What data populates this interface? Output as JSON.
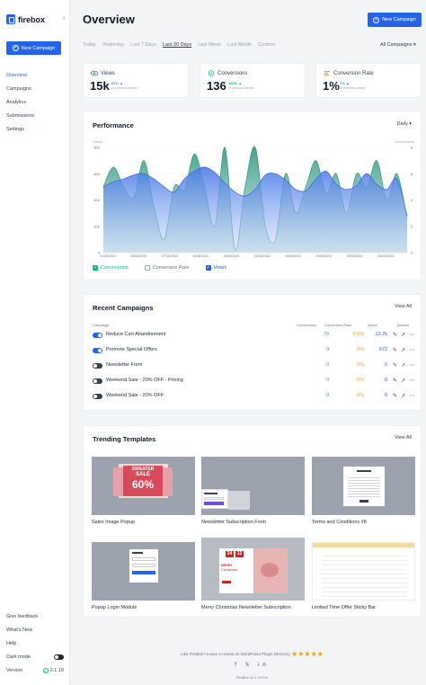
{
  "sidebar": {
    "logo_text": "firebox",
    "collapse_glyph": "‹",
    "new_campaign": "New Campaign",
    "nav": [
      {
        "label": "Overview",
        "active": true
      },
      {
        "label": "Campaigns"
      },
      {
        "label": "Analytics"
      },
      {
        "label": "Submissions"
      },
      {
        "label": "Settings"
      }
    ],
    "bottom": {
      "feedback": "Give feedback",
      "whats_new": "What's New",
      "help": "Help",
      "dark_mode": "Dark mode",
      "version_label": "Version",
      "version_value": "2.1.19"
    }
  },
  "header": {
    "title": "Overview",
    "new_campaign": "New Campaign",
    "date_tabs": [
      "Today",
      "Yesterday",
      "Last 7 Days",
      "Last 30 Days",
      "Last Week",
      "Last Month",
      "Custom"
    ],
    "active_tab": "Last 30 Days",
    "campaign_filter": "All Campaigns ▾"
  },
  "stats": [
    {
      "label": "Views",
      "value": "15k",
      "change": "67% ▲",
      "note": "vs previous period",
      "icon": "eye-icon",
      "color": "#2563eb"
    },
    {
      "label": "Conversions",
      "value": "136",
      "change": "100% ▲",
      "note": "vs previous period",
      "icon": "conversions-icon",
      "color": "#10b981"
    },
    {
      "label": "Conversion Rate",
      "value": "1%",
      "change": "7% ▲",
      "note": "vs previous period",
      "icon": "rate-icon",
      "color": "#f59e0b"
    }
  ],
  "performance": {
    "title": "Performance",
    "interval": "Daily ▾",
    "legend": {
      "conversions": "Conversions",
      "conversion_rate": "Conversion Rate",
      "views": "Views"
    }
  },
  "chart_data": {
    "type": "area",
    "title": "Performance",
    "xlabel": "",
    "ylabel": "Views",
    "y2label": "Conversions",
    "x": [
      "01/08/2024",
      "04/08/2024",
      "07/08/2024",
      "10/08/2024",
      "13/08/2024",
      "16/08/2024",
      "19/08/2024",
      "22/08/2024",
      "25/08/2024",
      "28/08/2024"
    ],
    "ylim": [
      0,
      800
    ],
    "y_ticks": [
      0,
      200,
      400,
      600,
      800
    ],
    "y2lim": [
      0,
      8
    ],
    "y2_ticks": [
      0,
      2,
      4,
      6,
      8
    ],
    "series": [
      {
        "name": "Views",
        "axis": "left",
        "color": "#3b6fe0",
        "values": [
          500,
          540,
          560,
          590,
          600,
          560,
          500,
          460,
          560,
          620,
          650,
          610,
          530,
          460,
          430,
          480,
          590,
          600,
          550,
          480,
          470,
          560,
          620,
          520,
          480,
          510,
          600,
          520,
          480,
          560,
          280
        ]
      },
      {
        "name": "Conversions",
        "axis": "right",
        "color": "#3d9b86",
        "values": [
          5,
          6.5,
          5,
          4.2,
          7,
          3.5,
          1,
          5,
          4.8,
          7.5,
          5,
          2,
          8,
          0.2,
          5,
          8,
          2,
          1,
          6,
          3,
          5,
          7,
          4.5,
          6,
          3,
          6,
          5,
          7,
          4,
          6,
          2.5
        ]
      }
    ]
  },
  "recent": {
    "title": "Recent Campaigns",
    "view_all": "View All",
    "headers": {
      "campaign": "Campaign",
      "conversions": "Conversions",
      "rate": "Conversion Rate",
      "views": "Views",
      "actions": "Actions"
    },
    "rows": [
      {
        "name": "Reduce Cart Abandonment",
        "enabled": true,
        "conversions": "79",
        "rate": "0.6%",
        "views": "13.7k"
      },
      {
        "name": "Promote Special Offers",
        "enabled": true,
        "conversions": "0",
        "rate": "0%",
        "views": "672"
      },
      {
        "name": "Newsletter Form",
        "enabled": false,
        "conversions": "0",
        "rate": "0%",
        "views": "0"
      },
      {
        "name": "Weekend Sale - 20% OFF - Pricing",
        "enabled": false,
        "conversions": "0",
        "rate": "0%",
        "views": "0"
      },
      {
        "name": "Weekend Sale - 20% OFF",
        "enabled": false,
        "conversions": "0",
        "rate": "0%",
        "views": "0"
      }
    ]
  },
  "templates": {
    "title": "Trending Templates",
    "view_all": "View All",
    "items": [
      {
        "caption": "Sales Image Popup",
        "art_text_1": "SWEATER",
        "art_text_2": "SALE",
        "art_text_3": "60%"
      },
      {
        "caption": "Newsletter Subscription Form"
      },
      {
        "caption": "Terms and Conditions #8"
      },
      {
        "caption": "Popup Login Module"
      },
      {
        "caption": "Merry Christmas Newsletter Subscription",
        "art_text_1": "24",
        "art_text_2": "12",
        "art_text_3": "MERRY",
        "art_text_4": "Christmas"
      },
      {
        "caption": "Limited Time Offer Sticky Bar"
      }
    ]
  },
  "footer": {
    "review_text": "Like FireBox? Leave a review on WordPress Plugin Directory",
    "stars": "★★★★★",
    "social": "f 𝕏 in",
    "version": "FireBox v2.1.19 Pro"
  }
}
